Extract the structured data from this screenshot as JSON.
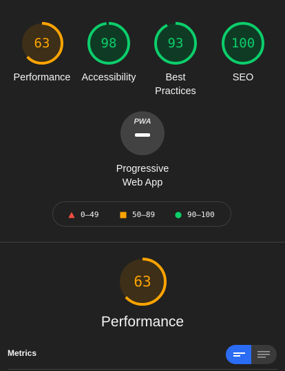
{
  "gauges": [
    {
      "label": "Performance",
      "score": "63",
      "value": 63,
      "rating": "average"
    },
    {
      "label": "Accessibility",
      "score": "98",
      "value": 98,
      "rating": "pass"
    },
    {
      "label": "Best Practices",
      "label_line1": "Best",
      "label_line2": "Practices",
      "score": "93",
      "value": 93,
      "rating": "pass"
    },
    {
      "label": "SEO",
      "score": "100",
      "value": 100,
      "rating": "pass"
    }
  ],
  "pwa": {
    "badge_text": "PWA",
    "label_line1": "Progressive",
    "label_line2": "Web App"
  },
  "legend": {
    "fail": "0–49",
    "average": "50–89",
    "pass": "90–100"
  },
  "performance_section": {
    "score": "63",
    "value": 63,
    "title": "Performance",
    "metrics_label": "Metrics"
  },
  "colors": {
    "background": "#212121",
    "pass": "#0cce6b",
    "pass_fill": "#0f3b25",
    "average": "#ffa400",
    "average_fill": "#3d2f18",
    "fail": "#ff4e42",
    "toggle_active": "#2b6cf5"
  },
  "icons": {
    "fail": "triangle-icon",
    "average": "square-icon",
    "pass": "circle-icon",
    "pwa": "pwa-badge-icon",
    "view_compact": "compact-list-icon",
    "view_expanded": "expanded-list-icon"
  }
}
